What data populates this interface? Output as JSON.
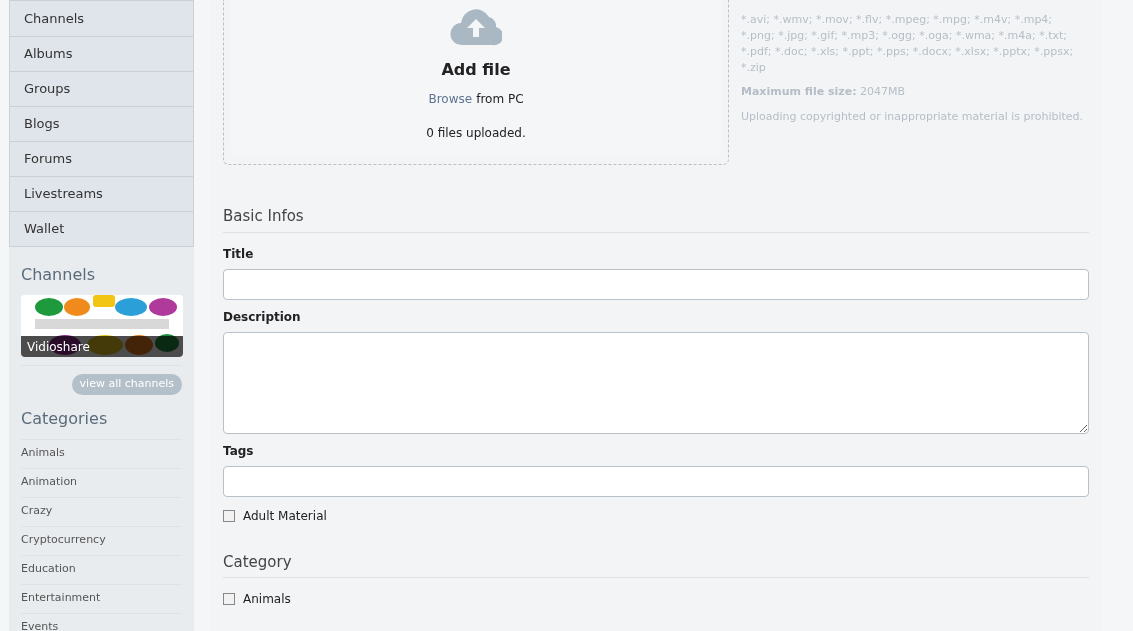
{
  "nav": [
    {
      "label": "Channels"
    },
    {
      "label": "Albums"
    },
    {
      "label": "Groups"
    },
    {
      "label": "Blogs"
    },
    {
      "label": "Forums"
    },
    {
      "label": "Livestreams"
    },
    {
      "label": "Wallet"
    }
  ],
  "channels": {
    "heading": "Channels",
    "items": [
      {
        "kind": "picture",
        "caption": "Vidioshare"
      }
    ],
    "view_all": "view all channels"
  },
  "categories": {
    "heading": "Categories",
    "items": [
      "Animals",
      "Animation",
      "Crazy",
      "Cryptocurrency",
      "Education",
      "Entertainment",
      "Events"
    ]
  },
  "upload": {
    "title": "Add file",
    "browse_link": "Browse",
    "browse_rest": "from PC",
    "status": "0 files uploaded."
  },
  "upload_info": {
    "extensions": "*.avi; *.wmv; *.mov; *.flv; *.mpeg; *.mpg; *.m4v; *.mp4; *.png; *.jpg; *.gif; *.mp3; *.ogg; *.oga; *.wma; *.m4a; *.txt; *.pdf; *.doc; *.xls; *.ppt; *.pps; *.docx; *.xlsx; *.pptx; *.ppsx; *.zip",
    "max_size": "**Maximum file size:** 2047MB",
    "notice": "Uploading copyrighted or inappropriate material is prohibited."
  },
  "basic_infos": {
    "heading": "Basic Infos",
    "fields": [
      {
        "kind": "input",
        "label": "Title"
      },
      {
        "kind": "textarea",
        "label": "Description"
      },
      {
        "kind": "input",
        "label": "Tags"
      }
    ],
    "adult": {
      "label": "Adult Material",
      "checked": false
    }
  },
  "category": {
    "heading": "Category",
    "options": [
      {
        "label": "Animals",
        "checked": false
      }
    ]
  }
}
